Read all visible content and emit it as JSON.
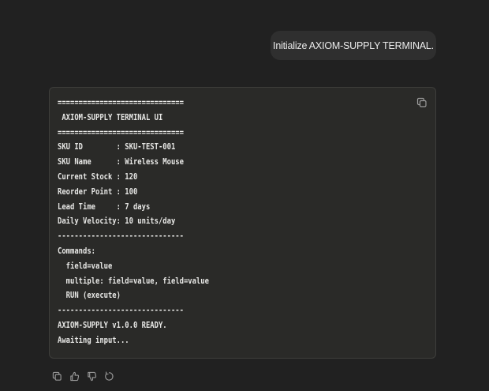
{
  "chat": {
    "user_message": "Initialize AXIOM-SUPPLY TERMINAL.",
    "code_lines": [
      "==============================",
      " AXIOM-SUPPLY TERMINAL UI",
      "==============================",
      "SKU ID        : SKU-TEST-001",
      "SKU Name      : Wireless Mouse",
      "Current Stock : 120",
      "Reorder Point : 100",
      "Lead Time     : 7 days",
      "Daily Velocity: 10 units/day",
      "------------------------------",
      "Commands:",
      "  field=value",
      "  multiple: field=value, field=value",
      "  RUN (execute)",
      "------------------------------",
      "AXIOM-SUPPLY v1.0.0 READY.",
      "Awaiting input..."
    ]
  },
  "icons": {
    "code_copy": "copy-icon",
    "actions": [
      "copy-icon",
      "thumbs-up-icon",
      "thumbs-down-icon",
      "regenerate-icon"
    ]
  },
  "colors": {
    "background": "#212121",
    "user_bubble": "#2f2f2f",
    "code_block": "#2a2a28",
    "text": "#e8e8e6",
    "icon": "#9b9b9b"
  }
}
